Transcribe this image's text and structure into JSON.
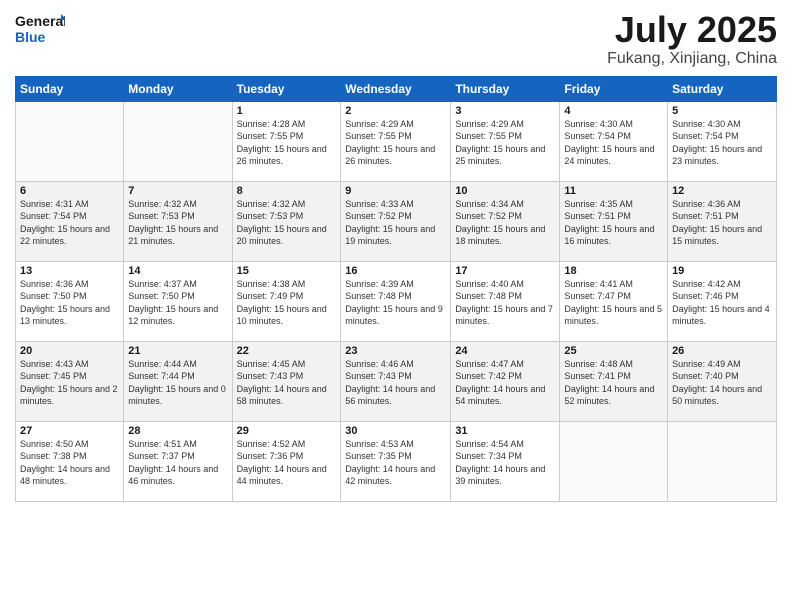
{
  "logo": {
    "line1": "General",
    "line2": "Blue"
  },
  "title": "July 2025",
  "subtitle": "Fukang, Xinjiang, China",
  "days_of_week": [
    "Sunday",
    "Monday",
    "Tuesday",
    "Wednesday",
    "Thursday",
    "Friday",
    "Saturday"
  ],
  "weeks": [
    [
      {
        "num": "",
        "sunrise": "",
        "sunset": "",
        "daylight": ""
      },
      {
        "num": "",
        "sunrise": "",
        "sunset": "",
        "daylight": ""
      },
      {
        "num": "1",
        "sunrise": "Sunrise: 4:28 AM",
        "sunset": "Sunset: 7:55 PM",
        "daylight": "Daylight: 15 hours and 26 minutes."
      },
      {
        "num": "2",
        "sunrise": "Sunrise: 4:29 AM",
        "sunset": "Sunset: 7:55 PM",
        "daylight": "Daylight: 15 hours and 26 minutes."
      },
      {
        "num": "3",
        "sunrise": "Sunrise: 4:29 AM",
        "sunset": "Sunset: 7:55 PM",
        "daylight": "Daylight: 15 hours and 25 minutes."
      },
      {
        "num": "4",
        "sunrise": "Sunrise: 4:30 AM",
        "sunset": "Sunset: 7:54 PM",
        "daylight": "Daylight: 15 hours and 24 minutes."
      },
      {
        "num": "5",
        "sunrise": "Sunrise: 4:30 AM",
        "sunset": "Sunset: 7:54 PM",
        "daylight": "Daylight: 15 hours and 23 minutes."
      }
    ],
    [
      {
        "num": "6",
        "sunrise": "Sunrise: 4:31 AM",
        "sunset": "Sunset: 7:54 PM",
        "daylight": "Daylight: 15 hours and 22 minutes."
      },
      {
        "num": "7",
        "sunrise": "Sunrise: 4:32 AM",
        "sunset": "Sunset: 7:53 PM",
        "daylight": "Daylight: 15 hours and 21 minutes."
      },
      {
        "num": "8",
        "sunrise": "Sunrise: 4:32 AM",
        "sunset": "Sunset: 7:53 PM",
        "daylight": "Daylight: 15 hours and 20 minutes."
      },
      {
        "num": "9",
        "sunrise": "Sunrise: 4:33 AM",
        "sunset": "Sunset: 7:52 PM",
        "daylight": "Daylight: 15 hours and 19 minutes."
      },
      {
        "num": "10",
        "sunrise": "Sunrise: 4:34 AM",
        "sunset": "Sunset: 7:52 PM",
        "daylight": "Daylight: 15 hours and 18 minutes."
      },
      {
        "num": "11",
        "sunrise": "Sunrise: 4:35 AM",
        "sunset": "Sunset: 7:51 PM",
        "daylight": "Daylight: 15 hours and 16 minutes."
      },
      {
        "num": "12",
        "sunrise": "Sunrise: 4:36 AM",
        "sunset": "Sunset: 7:51 PM",
        "daylight": "Daylight: 15 hours and 15 minutes."
      }
    ],
    [
      {
        "num": "13",
        "sunrise": "Sunrise: 4:36 AM",
        "sunset": "Sunset: 7:50 PM",
        "daylight": "Daylight: 15 hours and 13 minutes."
      },
      {
        "num": "14",
        "sunrise": "Sunrise: 4:37 AM",
        "sunset": "Sunset: 7:50 PM",
        "daylight": "Daylight: 15 hours and 12 minutes."
      },
      {
        "num": "15",
        "sunrise": "Sunrise: 4:38 AM",
        "sunset": "Sunset: 7:49 PM",
        "daylight": "Daylight: 15 hours and 10 minutes."
      },
      {
        "num": "16",
        "sunrise": "Sunrise: 4:39 AM",
        "sunset": "Sunset: 7:48 PM",
        "daylight": "Daylight: 15 hours and 9 minutes."
      },
      {
        "num": "17",
        "sunrise": "Sunrise: 4:40 AM",
        "sunset": "Sunset: 7:48 PM",
        "daylight": "Daylight: 15 hours and 7 minutes."
      },
      {
        "num": "18",
        "sunrise": "Sunrise: 4:41 AM",
        "sunset": "Sunset: 7:47 PM",
        "daylight": "Daylight: 15 hours and 5 minutes."
      },
      {
        "num": "19",
        "sunrise": "Sunrise: 4:42 AM",
        "sunset": "Sunset: 7:46 PM",
        "daylight": "Daylight: 15 hours and 4 minutes."
      }
    ],
    [
      {
        "num": "20",
        "sunrise": "Sunrise: 4:43 AM",
        "sunset": "Sunset: 7:45 PM",
        "daylight": "Daylight: 15 hours and 2 minutes."
      },
      {
        "num": "21",
        "sunrise": "Sunrise: 4:44 AM",
        "sunset": "Sunset: 7:44 PM",
        "daylight": "Daylight: 15 hours and 0 minutes."
      },
      {
        "num": "22",
        "sunrise": "Sunrise: 4:45 AM",
        "sunset": "Sunset: 7:43 PM",
        "daylight": "Daylight: 14 hours and 58 minutes."
      },
      {
        "num": "23",
        "sunrise": "Sunrise: 4:46 AM",
        "sunset": "Sunset: 7:43 PM",
        "daylight": "Daylight: 14 hours and 56 minutes."
      },
      {
        "num": "24",
        "sunrise": "Sunrise: 4:47 AM",
        "sunset": "Sunset: 7:42 PM",
        "daylight": "Daylight: 14 hours and 54 minutes."
      },
      {
        "num": "25",
        "sunrise": "Sunrise: 4:48 AM",
        "sunset": "Sunset: 7:41 PM",
        "daylight": "Daylight: 14 hours and 52 minutes."
      },
      {
        "num": "26",
        "sunrise": "Sunrise: 4:49 AM",
        "sunset": "Sunset: 7:40 PM",
        "daylight": "Daylight: 14 hours and 50 minutes."
      }
    ],
    [
      {
        "num": "27",
        "sunrise": "Sunrise: 4:50 AM",
        "sunset": "Sunset: 7:38 PM",
        "daylight": "Daylight: 14 hours and 48 minutes."
      },
      {
        "num": "28",
        "sunrise": "Sunrise: 4:51 AM",
        "sunset": "Sunset: 7:37 PM",
        "daylight": "Daylight: 14 hours and 46 minutes."
      },
      {
        "num": "29",
        "sunrise": "Sunrise: 4:52 AM",
        "sunset": "Sunset: 7:36 PM",
        "daylight": "Daylight: 14 hours and 44 minutes."
      },
      {
        "num": "30",
        "sunrise": "Sunrise: 4:53 AM",
        "sunset": "Sunset: 7:35 PM",
        "daylight": "Daylight: 14 hours and 42 minutes."
      },
      {
        "num": "31",
        "sunrise": "Sunrise: 4:54 AM",
        "sunset": "Sunset: 7:34 PM",
        "daylight": "Daylight: 14 hours and 39 minutes."
      },
      {
        "num": "",
        "sunrise": "",
        "sunset": "",
        "daylight": ""
      },
      {
        "num": "",
        "sunrise": "",
        "sunset": "",
        "daylight": ""
      }
    ]
  ]
}
